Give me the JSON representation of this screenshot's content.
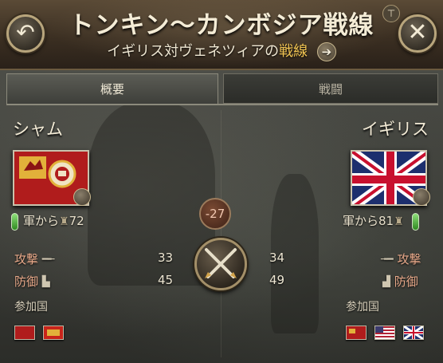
{
  "header": {
    "title": "トンキン〜カンボジア戦線",
    "subtitle_prefix": "イギリス対ヴェネツィアの",
    "subtitle_highlight": "戦線",
    "goto_glyph": "➔",
    "back_glyph": "↶",
    "close_glyph": "✕",
    "pin_glyph": "⊤"
  },
  "tabs": [
    {
      "label": "概要",
      "active": true
    },
    {
      "label": "戦闘",
      "active": false
    }
  ],
  "left": {
    "name": "シャム",
    "army_label": "軍から",
    "army_value": "72",
    "attack_label": "攻撃",
    "attack_value": "33",
    "defense_label": "防御",
    "defense_value": "45",
    "participants_label": "参加国"
  },
  "right": {
    "name": "イギリス",
    "army_label": "軍から",
    "army_value": "81",
    "attack_label": "攻撃",
    "attack_value": "34",
    "defense_label": "防御",
    "defense_value": "49",
    "participants_label": "参加国"
  },
  "center": {
    "modifier": "-27"
  },
  "icons": {
    "back": "back-arrow-icon",
    "close": "close-icon",
    "attack": "rifle-icon",
    "defense": "fortification-icon",
    "battle": "crossed-sabres-icon"
  },
  "colors": {
    "accent_gold": "#f1c453",
    "attack_label": "#e8a98a",
    "army_bar": "#4fb33a",
    "siam_red": "#b01c1c",
    "uk_blue": "#1d2f6e"
  }
}
